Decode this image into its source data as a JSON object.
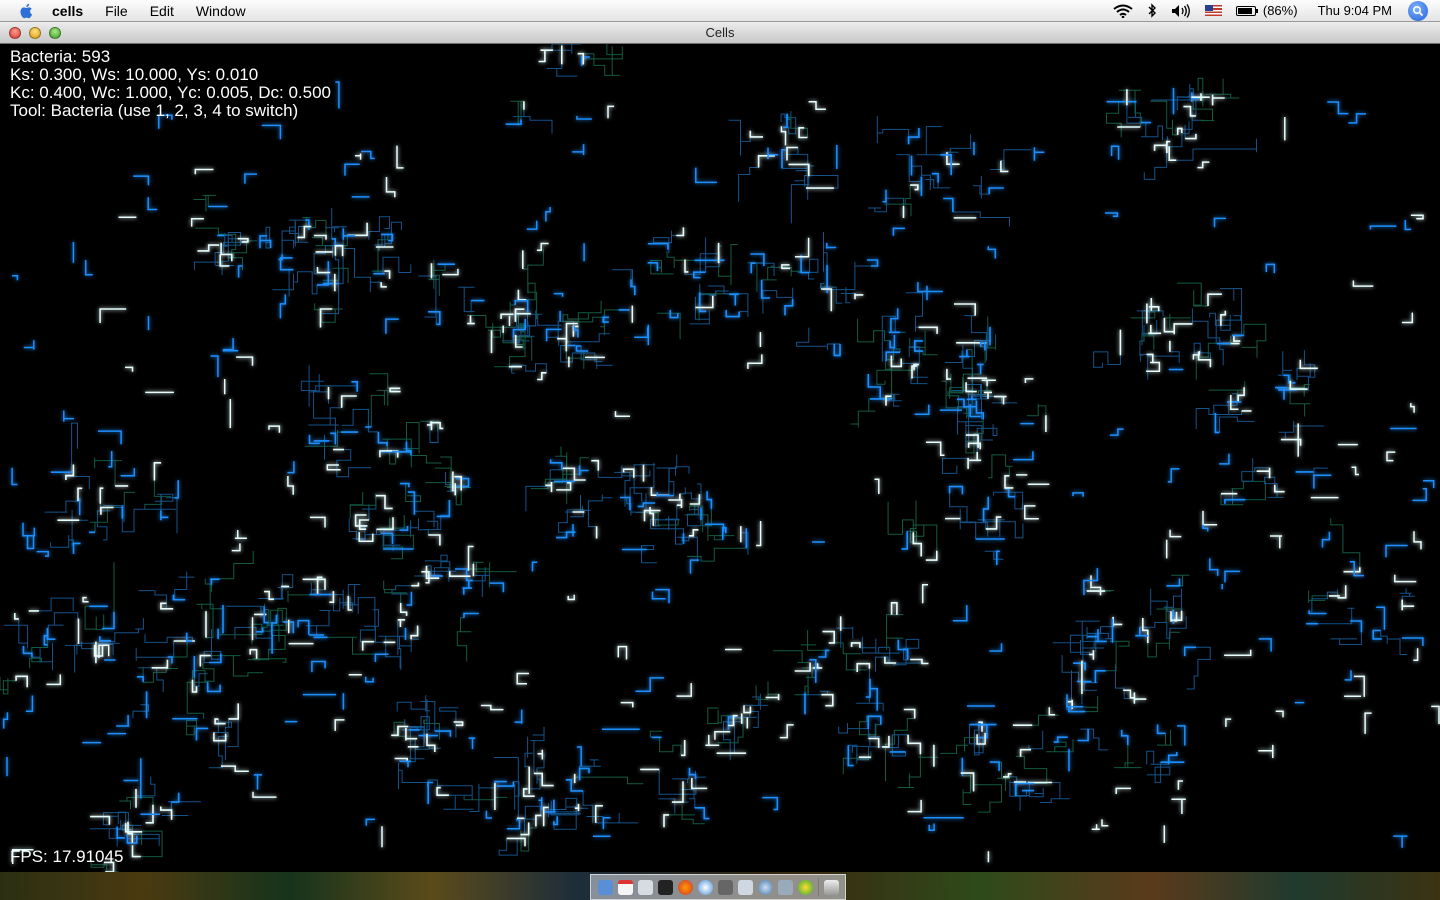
{
  "menubar": {
    "app_name": "cells",
    "menus": [
      "File",
      "Edit",
      "Window"
    ],
    "battery": "(86%)",
    "battery_level": 0.86,
    "clock": "Thu 9:04 PM",
    "icons": [
      "apple-icon",
      "wifi-icon",
      "bluetooth-icon",
      "volume-icon",
      "us-flag-icon",
      "battery-icon",
      "spotlight-icon"
    ]
  },
  "window": {
    "title": "Cells"
  },
  "hud": {
    "bacteria": "Bacteria: 593",
    "params_s": "Ks: 0.300, Ws: 10.000, Ys: 0.010",
    "params_c": "Kc: 0.400, Wc: 1.000, Yc: 0.005, Dc: 0.500",
    "tool": "Tool: Bacteria (use 1, 2, 3, 4 to switch)",
    "fps": "FPS: 17.91045"
  },
  "colors": {
    "bacteria_core": "#e8ffff",
    "bacteria_glow": "#1e90ff",
    "trail": "#1a6fb8",
    "trail_green": "#1a7a5a",
    "background": "#000000"
  },
  "dock": {
    "icons": [
      "finder-icon",
      "ical-icon",
      "mail-icon",
      "terminal-icon",
      "firefox-icon",
      "safari-icon",
      "x11-icon",
      "preview-icon",
      "itunes-icon",
      "network-icon",
      "java-icon",
      "trash-icon"
    ]
  }
}
